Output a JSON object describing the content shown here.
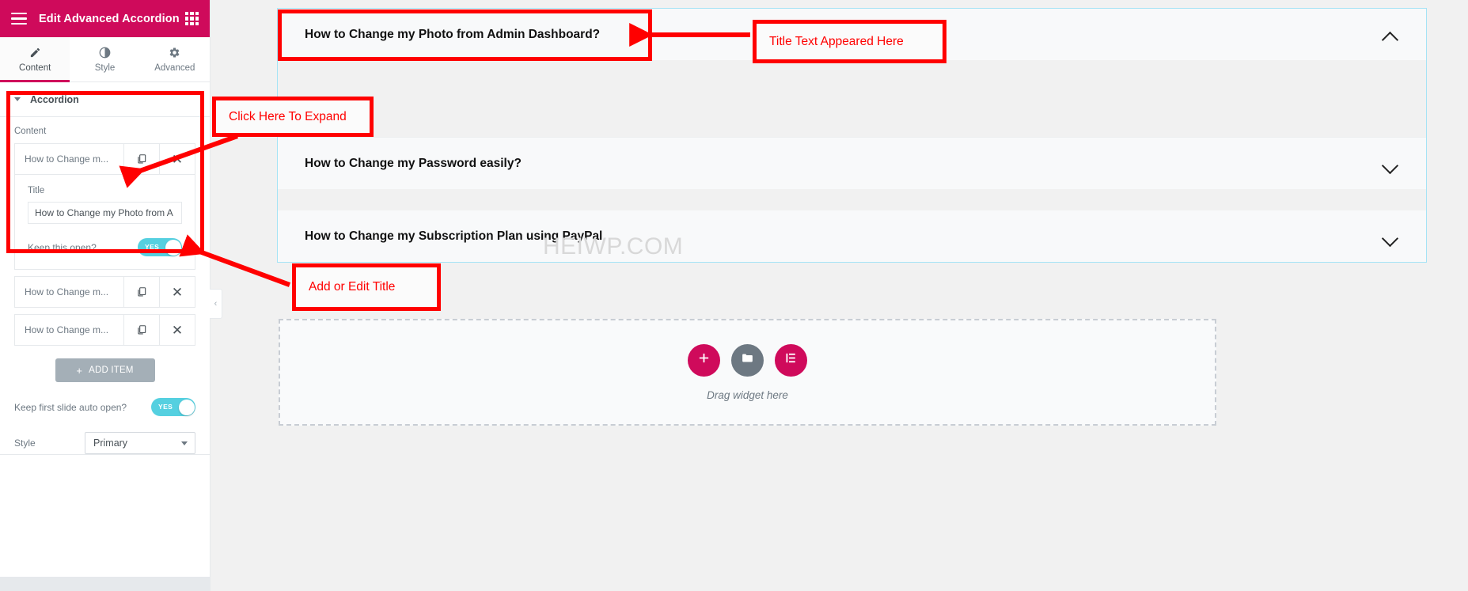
{
  "panel": {
    "header": {
      "title": "Edit Advanced Accordion",
      "menu_icon": "hamburger-icon",
      "apps_icon": "grid-apps-icon"
    },
    "tabs": [
      {
        "label": "Content",
        "icon": "pencil-icon",
        "active": true
      },
      {
        "label": "Style",
        "icon": "half-circle-icon",
        "active": false
      },
      {
        "label": "Advanced",
        "icon": "gear-icon",
        "active": false
      }
    ],
    "section": {
      "title": "Accordion",
      "content_label": "Content"
    },
    "repeater": {
      "items": [
        {
          "collapsed_title": "How to Change m...",
          "duplicate_icon": "copy-icon",
          "remove_icon": "close-x-icon",
          "expanded": true,
          "fields": {
            "title_label": "Title",
            "title_value": "How to Change my Photo from A",
            "title_placeholder": "Title",
            "keep_open_label": "Keep this open?",
            "keep_open_value": "YES"
          }
        },
        {
          "collapsed_title": "How to Change m...",
          "duplicate_icon": "copy-icon",
          "remove_icon": "close-x-icon",
          "expanded": false
        },
        {
          "collapsed_title": "How to Change m...",
          "duplicate_icon": "copy-icon",
          "remove_icon": "close-x-icon",
          "expanded": false
        }
      ],
      "add_item_label": "ADD ITEM",
      "add_item_icon": "plus-icon"
    },
    "settings": {
      "auto_open_label": "Keep first slide auto open?",
      "auto_open_value": "YES",
      "style_label": "Style",
      "style_value": "Primary"
    },
    "collapse_handle_icon": "chevron-left-icon"
  },
  "canvas": {
    "accordion": {
      "items": [
        {
          "title": "How to Change my Photo from Admin Dashboard?",
          "open": true,
          "chevron": "chevron-up-icon"
        },
        {
          "title": "How to Change my Password easily?",
          "open": false,
          "chevron": "chevron-down-icon"
        },
        {
          "title": "How to Change my Subscription Plan using PayPal",
          "open": false,
          "chevron": "chevron-down-icon"
        }
      ]
    },
    "watermark": "HEIWP.COM",
    "dropzone": {
      "label": "Drag widget here",
      "buttons": [
        {
          "icon": "plus-icon",
          "color": "#cf0a5b"
        },
        {
          "icon": "folder-icon",
          "color": "#6d7882"
        },
        {
          "icon": "elementor-e-icon",
          "color": "#cf0a5b"
        }
      ]
    }
  },
  "annotations": [
    {
      "text": "Title Text Appeared Here"
    },
    {
      "text": "Click Here To Expand"
    },
    {
      "text": "Add or Edit Title"
    }
  ],
  "colors": {
    "brand": "#cf0a5b",
    "switch_on": "#55d0e0",
    "annotation": "#ff0000",
    "panel_border": "#e6e9ec"
  }
}
